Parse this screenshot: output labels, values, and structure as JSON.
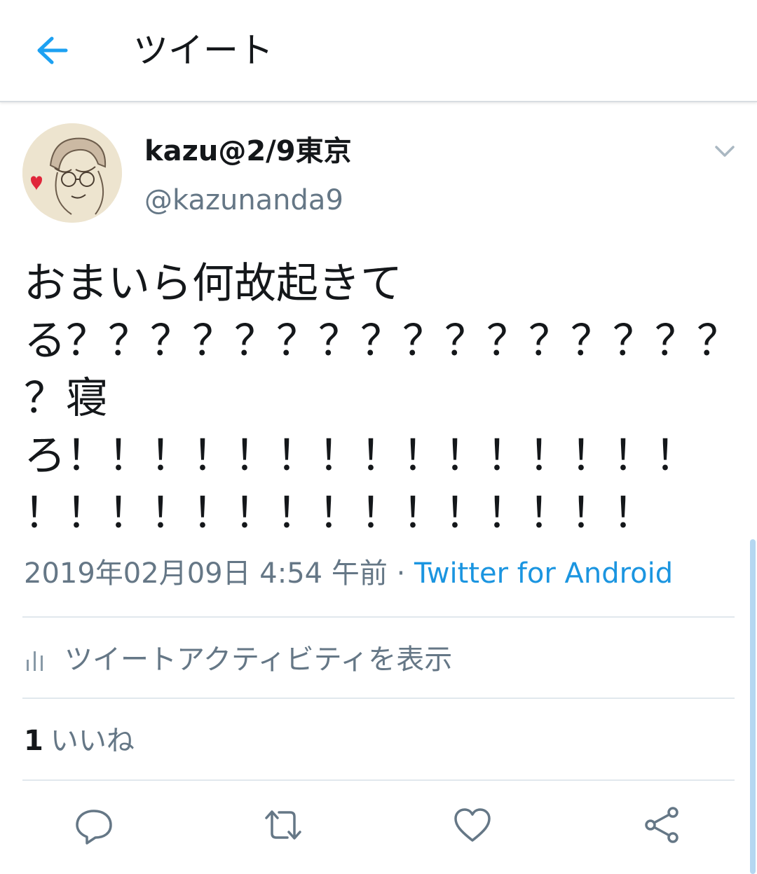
{
  "header": {
    "title": "ツイート",
    "back_icon": "arrow-left-icon",
    "accent": "#1da1f2"
  },
  "tweet": {
    "display_name": "kazu@2/9東京",
    "username": "@kazunanda9",
    "text": "おまいら何故起きて\nる？？？？？？？？？？？？？？？？\n？寝\nろ！！！！！！！！！！！！！！！\n！！！！！！！！！！！！！！！",
    "timestamp": "2019年02月09日 4:54 午前",
    "separator": " · ",
    "source": "Twitter for Android"
  },
  "activity": {
    "label": "ツイートアクティビティを表示",
    "icon": "bar-chart-icon"
  },
  "stats": {
    "likes_count": "1",
    "likes_label": "いいね"
  },
  "actions": {
    "reply_icon": "reply-icon",
    "retweet_icon": "retweet-icon",
    "like_icon": "heart-icon",
    "share_icon": "share-icon"
  },
  "colors": {
    "primary_text": "#14171a",
    "secondary_text": "#657786",
    "link": "#1b95e0",
    "divider": "#e1e8ed"
  }
}
